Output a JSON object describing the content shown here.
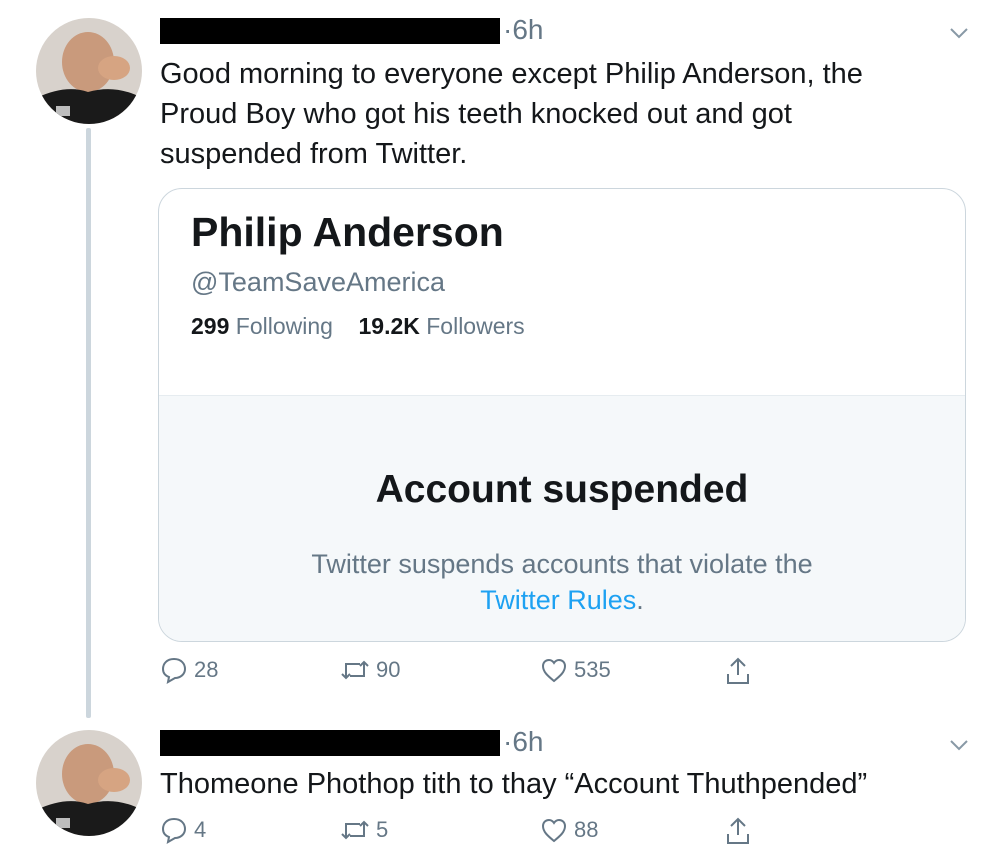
{
  "tweets": [
    {
      "time": "·6h",
      "text_lines": [
        "Good morning to everyone except Philip Anderson, the",
        "Proud Boy who got his teeth knocked out and got",
        "suspended from Twitter."
      ],
      "card": {
        "name": "Philip Anderson",
        "handle": "@TeamSaveAmerica",
        "following_count": "299",
        "following_label": "Following",
        "followers_count": "19.2K",
        "followers_label": "Followers",
        "suspended_title": "Account suspended",
        "suspended_text": "Twitter suspends accounts that violate the",
        "rules_link": "Twitter Rules",
        "period": "."
      },
      "replies": "28",
      "retweets": "90",
      "likes": "535"
    },
    {
      "time": "·6h",
      "text": "Thomeone Phothop tith to thay “Account Thuthpended”",
      "replies": "4",
      "retweets": "5",
      "likes": "88"
    }
  ],
  "icons": {
    "reply": "speech-bubble-icon",
    "retweet": "retweet-icon",
    "like": "heart-icon",
    "share": "share-icon",
    "menu": "chevron-down-icon"
  },
  "colors": {
    "accent": "#1da1f2",
    "muted": "#657786",
    "border": "#ccd6dd"
  }
}
